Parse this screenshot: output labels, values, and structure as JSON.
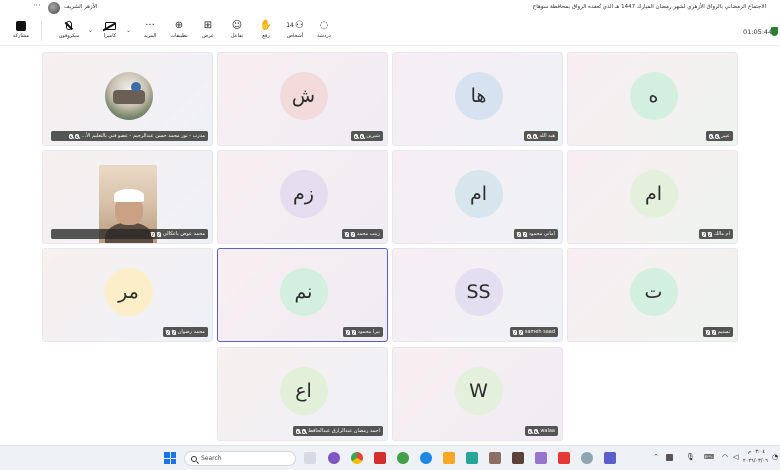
{
  "titlebar": {
    "meeting_title": "الاجتماع الرمضاني بالرواق الأزهري لشهر رمضان المبارك 1447 هـ الذي تُعقده الرواق بمحافظة سوهاج",
    "org_name": "الأزهر الشريف",
    "more_label": "···"
  },
  "toolbar": {
    "timer": "01:05:44",
    "buttons": [
      {
        "label": "مشاركة",
        "icon": "share-icon"
      },
      {
        "label": "ميكروفون",
        "icon": "mic-off-icon"
      },
      {
        "label": "كاميرا",
        "icon": "camera-off-icon"
      },
      {
        "label": "المزيد",
        "icon": "more-icon"
      },
      {
        "label": "تطبيقات",
        "icon": "apps-icon"
      },
      {
        "label": "عرض",
        "icon": "view-icon"
      },
      {
        "label": "تفاعل",
        "icon": "react-icon"
      },
      {
        "label": "رفع",
        "icon": "raise-hand-icon"
      },
      {
        "label": "أشخاص",
        "icon": "people-icon",
        "count": "14"
      },
      {
        "label": "دردشة",
        "icon": "chat-icon"
      }
    ]
  },
  "participants": [
    {
      "id": "p1",
      "name": "مدرب - نور محمد حسن عبدالرحيم - عضو فني بالتعليم الأ...",
      "avatar": "",
      "type": "photo",
      "color": ""
    },
    {
      "id": "p2",
      "name": "شيرين",
      "avatar": "ش",
      "type": "initials",
      "color": "#f3dada"
    },
    {
      "id": "p3",
      "name": "هبه الله",
      "avatar": "ها",
      "type": "initials",
      "color": "#d7e2f1"
    },
    {
      "id": "p4",
      "name": "عبير",
      "avatar": "ه",
      "type": "initials",
      "color": "#d3efe0"
    },
    {
      "id": "p5",
      "name": "محمد عوض باعكالي",
      "avatar": "",
      "type": "video",
      "color": ""
    },
    {
      "id": "p6",
      "name": "زينب محمد",
      "avatar": "زم",
      "type": "initials",
      "color": "#e6dcf0"
    },
    {
      "id": "p7",
      "name": "اماني محمود",
      "avatar": "ام",
      "type": "initials",
      "color": "#d7e6ec"
    },
    {
      "id": "p8",
      "name": "ام مالك",
      "avatar": "ام",
      "type": "initials",
      "color": "#e3f1dc"
    },
    {
      "id": "p9",
      "name": "محمد رضوان",
      "avatar": "مر",
      "type": "initials",
      "color": "#fbeec8"
    },
    {
      "id": "p10",
      "name": "نيرا محمود",
      "avatar": "نم",
      "type": "initials",
      "color": "#d3efe0"
    },
    {
      "id": "p11",
      "name": "sameh saad",
      "avatar": "SS",
      "type": "initials",
      "color": "#e3def0"
    },
    {
      "id": "p12",
      "name": "تسنيم",
      "avatar": "ت",
      "type": "initials",
      "color": "#d3efe0"
    },
    {
      "id": "p13",
      "name": "احمد رمضان عبدالرازق عبدالحافظ",
      "avatar": "اع",
      "type": "initials",
      "color": "#e2efd9"
    },
    {
      "id": "p14",
      "name": "walaa",
      "avatar": "W",
      "type": "initials",
      "color": "#e3f1dc"
    }
  ],
  "taskbar": {
    "search_placeholder": "Search",
    "clock_time": "٠٣:٠٤ م",
    "clock_date": "٢٠٢٦/٠٣/٠٦"
  }
}
